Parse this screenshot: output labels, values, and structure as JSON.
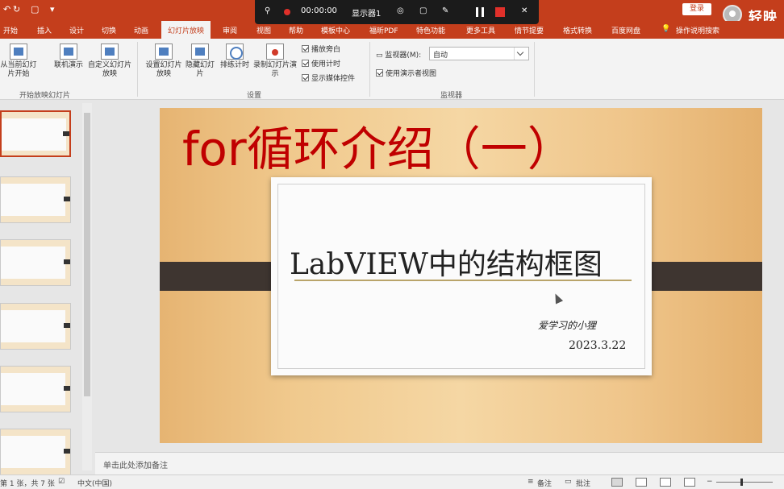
{
  "titlebar": {
    "quick_access": [
      "↶",
      "↻",
      "▢",
      "▾"
    ],
    "login_label": "登录",
    "logo_text": "轻映"
  },
  "recorder": {
    "pin": "⚲",
    "time": "00:00:00",
    "display": "显示器1",
    "close": "✕"
  },
  "tabs": [
    "开始",
    "插入",
    "设计",
    "切换",
    "动画",
    "幻灯片放映",
    "审阅",
    "视图",
    "帮助",
    "模板中心",
    "福昕PDF",
    "特色功能",
    "更多工具",
    "情节提要",
    "格式转换",
    "百度网盘",
    "操作说明搜索"
  ],
  "active_tab": "幻灯片放映",
  "ribbon": {
    "start_group": {
      "from_current": "从当前幻灯片开始",
      "online": "联机演示",
      "custom": "自定义幻灯片放映",
      "label": "开始放映幻灯片"
    },
    "setup_group": {
      "setup": "设置幻灯片放映",
      "hide": "隐藏幻灯片",
      "rehearse": "排练计时",
      "record": "录制幻灯片演示",
      "checks": [
        "播放旁白",
        "使用计时",
        "显示媒体控件"
      ],
      "label": "设置"
    },
    "monitor_group": {
      "monitor_label": "监视器(M):",
      "monitor_value": "自动",
      "presenter_view": "使用演示者视图",
      "label": "监视器"
    }
  },
  "slide": {
    "title": "for循环介绍（一）",
    "card_title": "LabVIEW中的结构框图",
    "author": "爱学习的小狸",
    "date": "2023.3.22"
  },
  "thumbnail_count": 6,
  "notes_placeholder": "单击此处添加备注",
  "status": {
    "slide_info": "第 1 张，共 7 张",
    "language": "中文(中国)",
    "notes_btn": "备注",
    "comments_btn": "批注"
  }
}
